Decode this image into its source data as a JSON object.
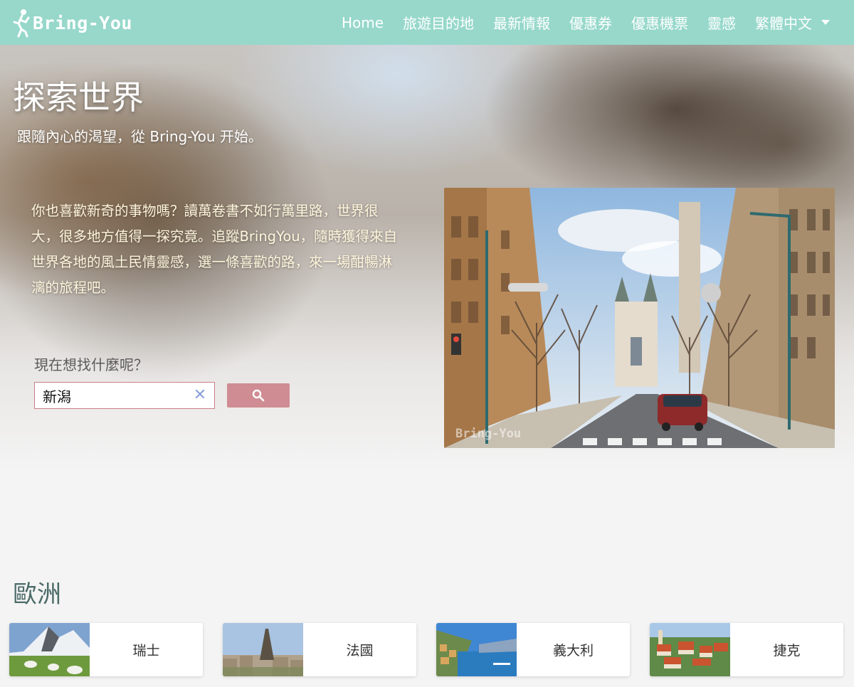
{
  "navbar": {
    "brand": "Bring-You",
    "links": [
      "Home",
      "旅遊目的地",
      "最新情報",
      "優惠券",
      "優惠機票",
      "靈感"
    ],
    "language": "繁體中文",
    "background": "#97d8cb"
  },
  "hero": {
    "title": "探索世界",
    "subtitle": "跟隨內心的渴望，從 Bring-You 开始。",
    "description": "你也喜歡新奇的事物嗎？讀萬卷書不如行萬里路，世界很大，很多地方值得一探究竟。追蹤BringYou，隨時獲得來自世界各地的風土民情靈感，選一條喜歡的路，來一場酣暢淋漓的旅程吧。",
    "search": {
      "label": "現在想找什麼呢？",
      "value": "新潟",
      "button_color": "#cf8d93"
    },
    "photo_watermark": "Bring-You"
  },
  "europe": {
    "title": "歐洲",
    "cards": [
      {
        "name": "瑞士",
        "thumb": "swiss-mountain-sheep-thumb"
      },
      {
        "name": "法國",
        "thumb": "paris-eiffel-tower-thumb"
      },
      {
        "name": "義大利",
        "thumb": "italy-coast-thumb"
      },
      {
        "name": "捷克",
        "thumb": "czech-old-town-thumb"
      }
    ]
  }
}
